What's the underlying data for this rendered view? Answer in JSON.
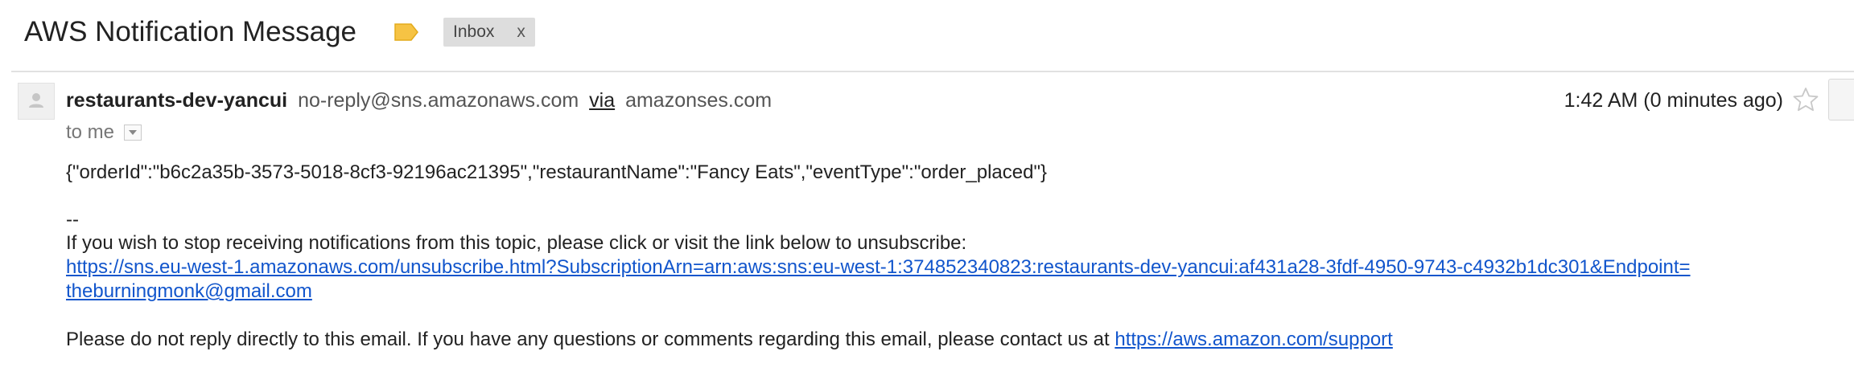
{
  "subject": "AWS Notification Message",
  "colors": {
    "label_icon": "#f6c344",
    "link": "#1155cc",
    "chip_bg": "#dddddd"
  },
  "label_chip": {
    "text": "Inbox",
    "close": "x"
  },
  "message": {
    "sender_name": "restaurants-dev-yancui",
    "sender_email": "no-reply@sns.amazonaws.com",
    "via_label": "via",
    "via_domain": "amazonses.com",
    "time": "1:42 AM (0 minutes ago)",
    "recipient": "to me",
    "icons": {
      "avatar": "default-person-icon",
      "star": "star-outline-icon",
      "details": "chevron-down-icon",
      "label": "label-tag-icon"
    }
  },
  "body": {
    "json_line": "{\"orderId\":\"b6c2a35b-3573-5018-8cf3-92196ac21395\",\"restaurantName\":\"Fancy Eats\",\"eventType\":\"order_placed\"}",
    "sig_dash": "--",
    "unsubscribe_text": "If you wish to stop receiving notifications from this topic, please click or visit the link below to unsubscribe:",
    "unsubscribe_link_line1": "https://sns.eu-west-1.amazonaws.com/unsubscribe.html?SubscriptionArn=arn:aws:sns:eu-west-1:374852340823:restaurants-dev-yancui:af431a28-3fdf-4950-9743-c4932b1dc301&Endpoint=",
    "unsubscribe_link_line2": "theburningmonk@gmail.com",
    "footer_text": "Please do not reply directly to this email. If you have any questions or comments regarding this email, please contact us at ",
    "support_link": "https://aws.amazon.com/support"
  }
}
